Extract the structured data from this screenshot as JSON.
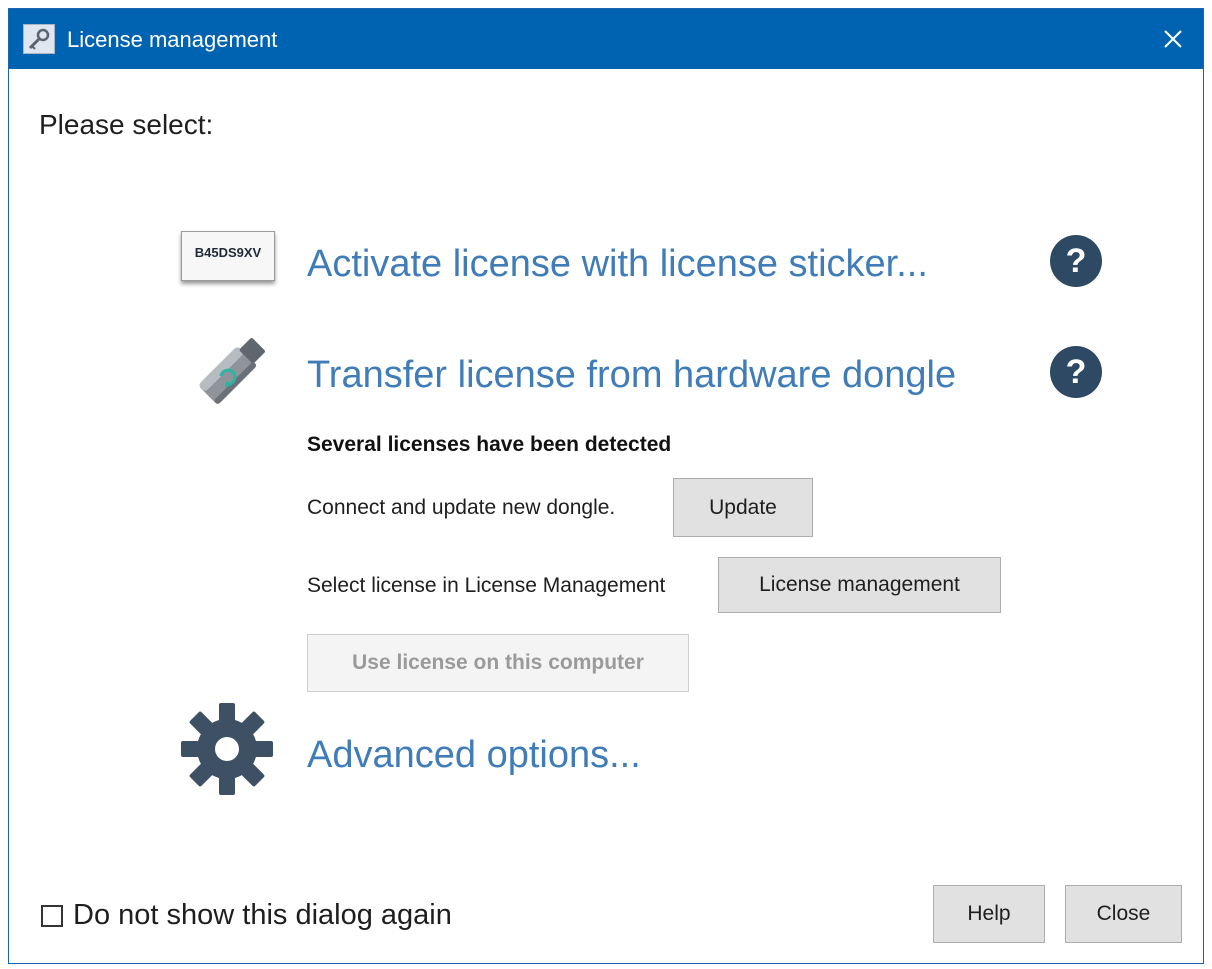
{
  "window": {
    "title": "License management",
    "title_icon": "key-icon",
    "close_icon": "close-icon",
    "accent_color": "#0063b1"
  },
  "main": {
    "prompt": "Please select:",
    "options": {
      "sticker": {
        "label": "Activate license with license sticker...",
        "sticker_code": "B45DS9XV",
        "help_symbol": "?"
      },
      "dongle": {
        "label": "Transfer license from hardware dongle",
        "help_symbol": "?"
      },
      "advanced": {
        "label": "Advanced options..."
      }
    },
    "dongle_panel": {
      "status": "Several licenses have been detected",
      "update_text": "Connect and update new dongle.",
      "update_button": "Update",
      "select_text": "Select license in License Management",
      "license_button": "License management",
      "use_license_button": "Use license on this computer"
    }
  },
  "footer": {
    "checkbox_label": "Do not show this dialog again",
    "checkbox_checked": false,
    "help_button": "Help",
    "close_button": "Close"
  },
  "colors": {
    "link": "#3f7cb8",
    "help_icon": "#2d4963"
  }
}
